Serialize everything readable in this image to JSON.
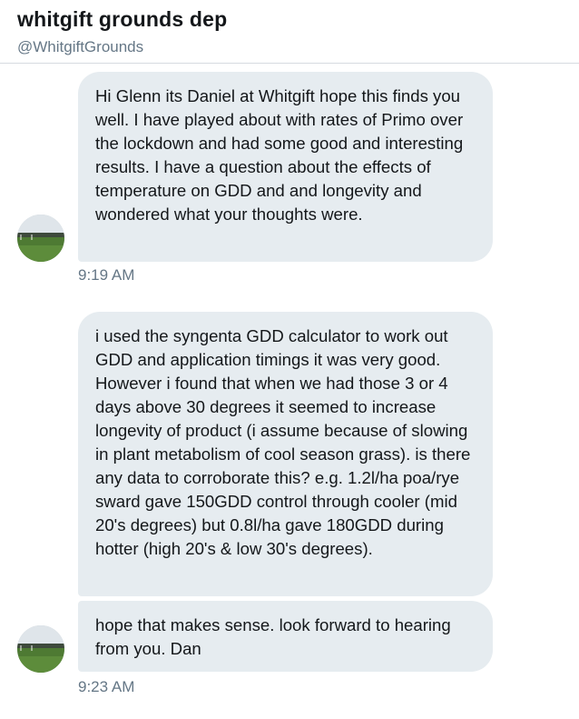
{
  "header": {
    "title": "whitgift grounds dep",
    "handle": "@WhitgiftGrounds"
  },
  "conversation": {
    "messages": [
      {
        "text": "Hi Glenn its Daniel at Whitgift hope this finds you well. I have played about with rates of Primo over the lockdown and had some good and interesting results. I have a question about the effects of temperature on GDD and and longevity and wondered what your thoughts were.",
        "timestamp": "9:19 AM"
      },
      {
        "text": "i used the syngenta GDD calculator to work out GDD and application timings it was very good. However i found that when we had those 3 or 4 days above 30 degrees it seemed to increase longevity of product (i assume because of slowing in plant metabolism of cool season grass). is there any data to corroborate this? e.g. 1.2l/ha poa/rye sward gave 150GDD control through cooler (mid 20's degrees) but 0.8l/ha gave 180GDD during hotter (high 20's & low 30's degrees)."
      },
      {
        "text": "hope that makes sense. look forward to hearing from you. Dan",
        "timestamp": "9:23 AM"
      }
    ]
  },
  "icons": {
    "avatar": "sports-field-photo"
  },
  "colors": {
    "bubble_background": "#e6ecf0",
    "secondary_text": "#657786",
    "primary_text": "#14171a"
  }
}
